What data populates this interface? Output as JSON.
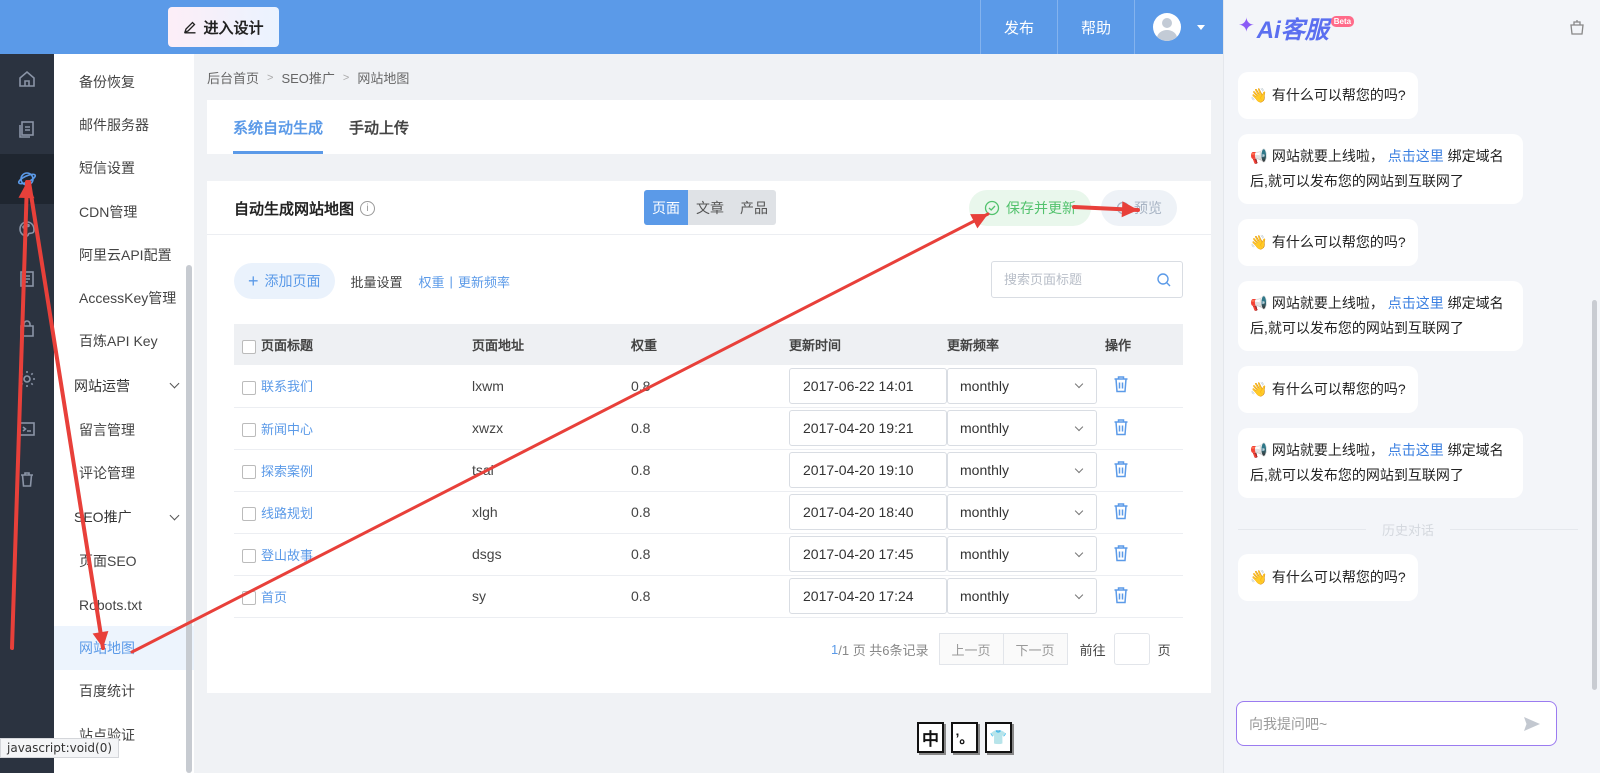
{
  "topbar": {
    "design_button": "进入设计",
    "links": [
      "发布",
      "帮助"
    ]
  },
  "rail": {
    "icons": [
      "home-icon",
      "pages-icon",
      "seo-planet-icon",
      "palette-icon",
      "article-icon",
      "store-icon",
      "settings-icon",
      "terminal-icon",
      "trash-icon"
    ],
    "active_index": 2
  },
  "subnav": {
    "items_top": [
      "备份恢复",
      "邮件服务器",
      "短信设置",
      "CDN管理",
      "阿里云API配置",
      "AccessKey管理",
      "百炼API Key"
    ],
    "group_ops": "网站运营",
    "items_ops": [
      "留言管理",
      "评论管理"
    ],
    "group_seo": "SEO推广",
    "items_seo": [
      "页面SEO",
      "Robots.txt",
      "网站地图",
      "百度统计",
      "站点验证"
    ]
  },
  "breadcrumb": [
    "后台首页",
    "SEO推广",
    "网站地图"
  ],
  "tabs": [
    "系统自动生成",
    "手动上传"
  ],
  "card": {
    "title": "自动生成网站地图",
    "info": "i",
    "segments": [
      "页面",
      "文章",
      "产品"
    ],
    "save_label": "保存并更新",
    "preview_label": "预览"
  },
  "toolbar": {
    "add_label": "添加页面",
    "batch_label": "批量设置",
    "weight_link": "权重",
    "separator": "|",
    "freq_link": "更新频率",
    "search_placeholder": "搜索页面标题"
  },
  "table": {
    "headers": [
      "页面标题",
      "页面地址",
      "权重",
      "更新时间",
      "更新频率",
      "操作"
    ],
    "rows": [
      {
        "title": "联系我们",
        "url": "lxwm",
        "weight": "0.8",
        "time": "2017-06-22 14:01",
        "freq": "monthly"
      },
      {
        "title": "新闻中心",
        "url": "xwzx",
        "weight": "0.8",
        "time": "2017-04-20 19:21",
        "freq": "monthly"
      },
      {
        "title": "探索案例",
        "url": "tsal",
        "weight": "0.8",
        "time": "2017-04-20 19:10",
        "freq": "monthly"
      },
      {
        "title": "线路规划",
        "url": "xlgh",
        "weight": "0.8",
        "time": "2017-04-20 18:40",
        "freq": "monthly"
      },
      {
        "title": "登山故事",
        "url": "dsgs",
        "weight": "0.8",
        "time": "2017-04-20 17:45",
        "freq": "monthly"
      },
      {
        "title": "首页",
        "url": "sy",
        "weight": "0.8",
        "time": "2017-04-20 17:24",
        "freq": "monthly"
      }
    ]
  },
  "pager": {
    "current": "1",
    "total_text": "/1 页 共6条记录",
    "prev": "上一页",
    "next": "下一页",
    "goto_label": "前往",
    "goto_suffix": "页"
  },
  "status_bar": "javascript:void(0)",
  "ime": [
    "中",
    "’。",
    "👕"
  ],
  "ai": {
    "logo_text": "Ai客服",
    "beta": "Beta",
    "greeting": "有什么可以帮您的吗?",
    "notice_prefix": "网站就要上线啦，",
    "notice_link": "点击这里",
    "notice_suffix": "绑定域名后,就可以发布您的网站到互联网了",
    "history_label": "历史对话",
    "input_placeholder": "向我提问吧~"
  },
  "colors": {
    "primary": "#5b9ae8",
    "sidebar_dark": "#2b3340",
    "annotation_red": "#e8403a",
    "success": "#52c26d"
  }
}
